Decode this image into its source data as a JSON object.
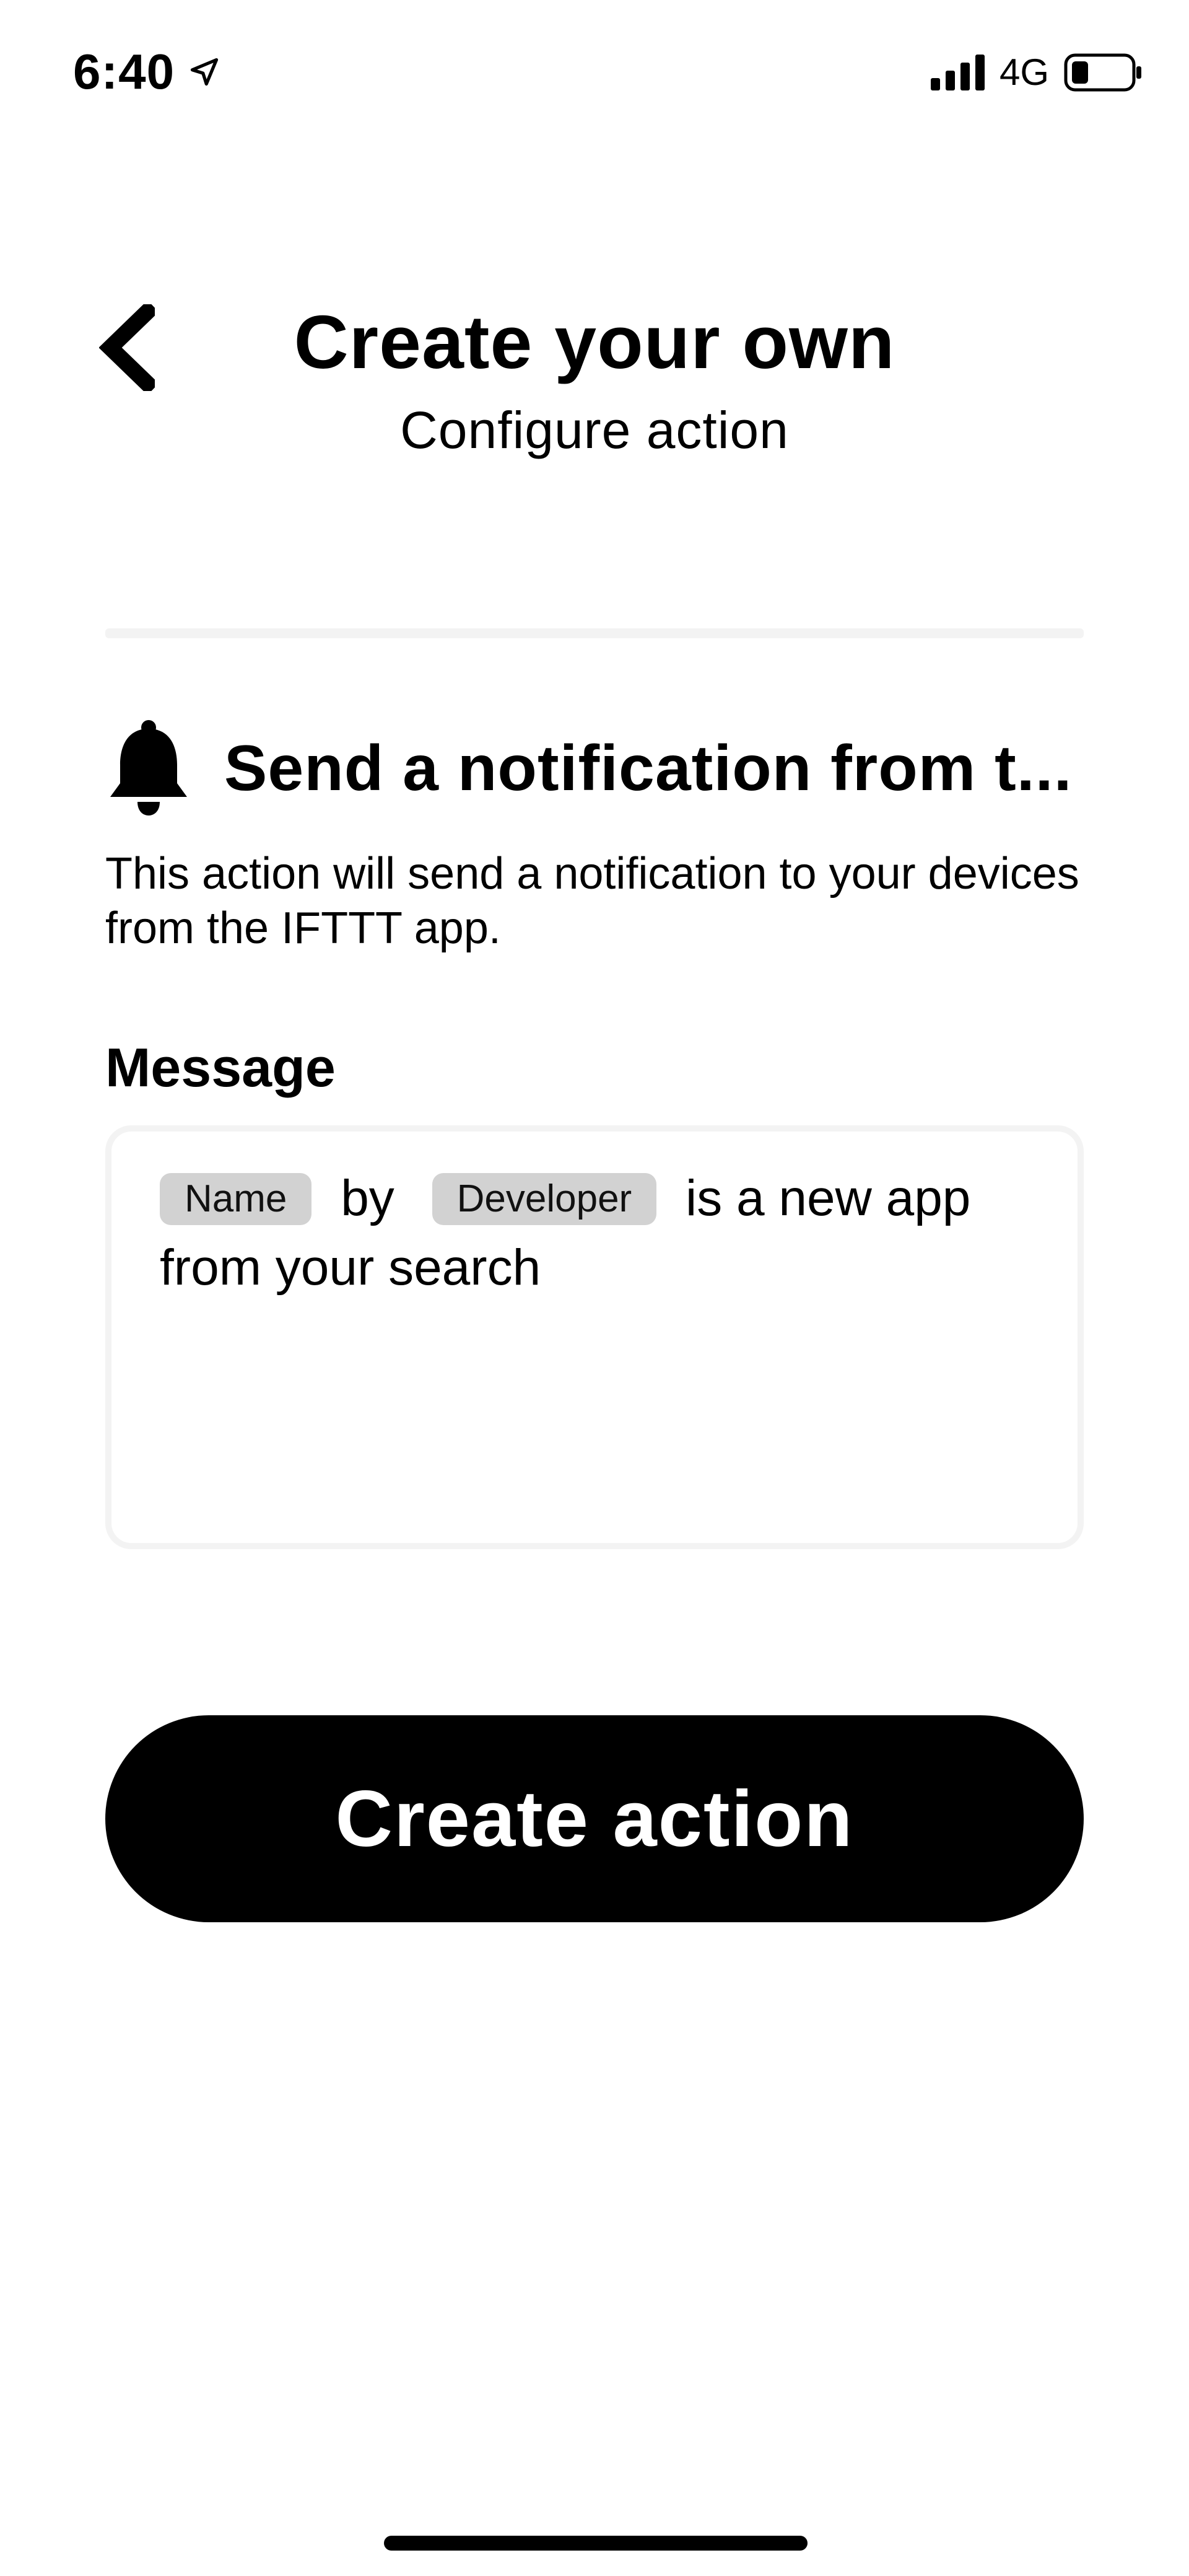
{
  "status_bar": {
    "time": "6:40",
    "network": "4G"
  },
  "header": {
    "title": "Create your own",
    "subtitle": "Configure action"
  },
  "action": {
    "title": "Send a notification from t...",
    "description": "This action will send a notification to your devices from the IFTTT app."
  },
  "message_field": {
    "label": "Message",
    "segments": {
      "chip_1": "Name",
      "text_1": "by",
      "chip_2": "Developer",
      "text_2": "is a new app from your search"
    }
  },
  "create_button": {
    "label": "Create action"
  },
  "icons": {
    "back": "chevron-left-icon",
    "location": "location-arrow-icon",
    "signal": "signal-bars-icon",
    "battery": "battery-icon",
    "action": "bell-icon"
  },
  "colors": {
    "primary_button": "#000000",
    "chip_background": "#d2d2d2",
    "divider": "#f3f3f3"
  }
}
